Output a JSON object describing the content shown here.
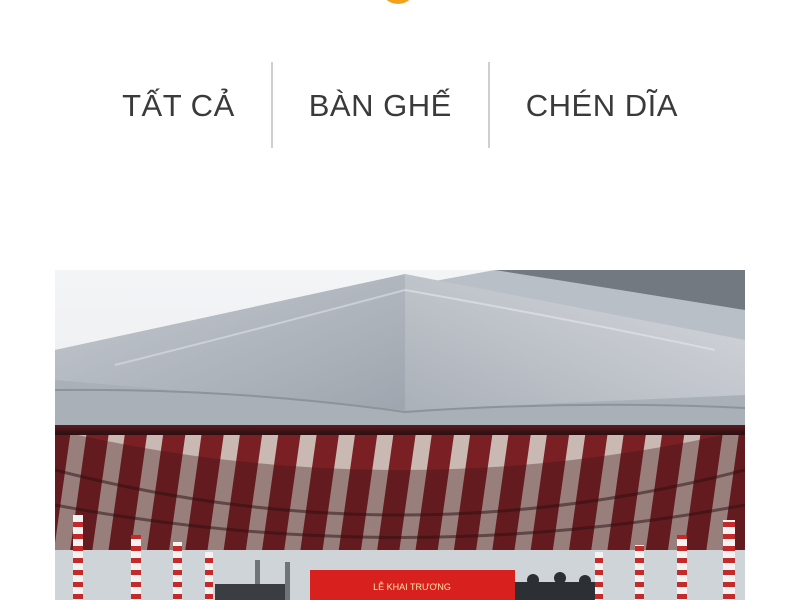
{
  "filters": {
    "items": [
      {
        "label": "TẤT CẢ"
      },
      {
        "label": "BÀN GHẾ"
      },
      {
        "label": "CHÉN DĨA"
      }
    ]
  },
  "photo": {
    "banner_text": "LỄ KHAI TRƯƠNG"
  },
  "colors": {
    "accent": "#f4a21e",
    "text": "#3a3a3a",
    "divider": "#cfcfcf"
  }
}
